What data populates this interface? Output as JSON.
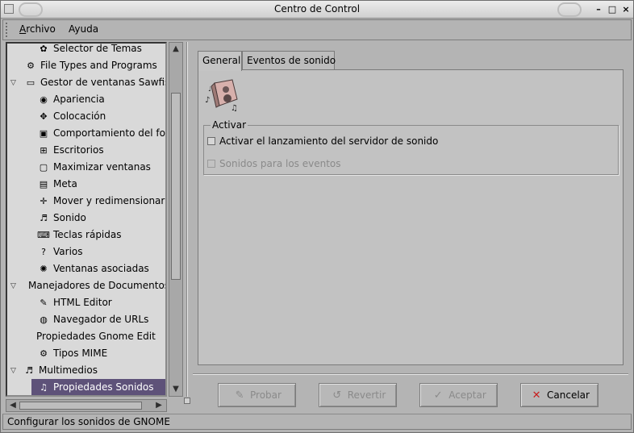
{
  "window": {
    "title": "Centro de Control",
    "minimize_glyph": "–",
    "maximize_glyph": "□",
    "close_glyph": "×"
  },
  "menu": [
    {
      "accel": "A",
      "rest": "rchivo"
    },
    {
      "accel": "A",
      "rest": "yuda"
    }
  ],
  "tree": [
    {
      "label": "Selector de Temas",
      "icon": "theme-icon",
      "level": 2
    },
    {
      "label": "File Types and Programs",
      "icon": "file-types-icon",
      "level": 1
    },
    {
      "label": "Gestor de ventanas Sawfish",
      "icon": "window-manager-icon",
      "level": 1,
      "expanded": true
    },
    {
      "label": "Apariencia",
      "icon": "eye-icon",
      "level": 2
    },
    {
      "label": "Colocación",
      "icon": "placement-icon",
      "level": 2
    },
    {
      "label": "Comportamiento del foco",
      "icon": "focus-icon",
      "level": 2
    },
    {
      "label": "Escritorios",
      "icon": "desktops-icon",
      "level": 2
    },
    {
      "label": "Maximizar ventanas",
      "icon": "maximize-icon",
      "level": 2
    },
    {
      "label": "Meta",
      "icon": "meta-icon",
      "level": 2
    },
    {
      "label": "Mover y redimensionar",
      "icon": "move-resize-icon",
      "level": 2
    },
    {
      "label": "Sonido",
      "icon": "drum-icon",
      "level": 2
    },
    {
      "label": "Teclas rápidas",
      "icon": "keys-icon",
      "level": 2
    },
    {
      "label": "Varios",
      "icon": "misc-icon",
      "level": 2
    },
    {
      "label": "Ventanas asociadas",
      "icon": "linked-windows-icon",
      "level": 2
    },
    {
      "label": "Manejadores de Documentos",
      "icon": "",
      "level": 0,
      "expanded": true
    },
    {
      "label": "HTML Editor",
      "icon": "pen-icon",
      "level": 2
    },
    {
      "label": "Navegador de URLs",
      "icon": "globe-icon",
      "level": 2
    },
    {
      "label": "Propiedades Gnome Edit",
      "icon": "",
      "level": 2
    },
    {
      "label": "Tipos MIME",
      "icon": "mime-icon",
      "level": 2
    },
    {
      "label": "Multimedios",
      "icon": "drum-icon",
      "level": 0,
      "expanded": true
    },
    {
      "label": "Propiedades Sonidos",
      "icon": "sound-props-icon",
      "level": 2,
      "selected": true
    }
  ],
  "tabs": [
    {
      "label": "General",
      "active": true
    },
    {
      "label": "Eventos de sonido",
      "active": false
    }
  ],
  "frame": {
    "label": "Activar"
  },
  "checks": [
    {
      "label": "Activar el lanzamiento del servidor de sonido",
      "checked": false,
      "enabled": true
    },
    {
      "label": "Sonidos para los eventos",
      "checked": false,
      "enabled": false
    }
  ],
  "buttons": [
    {
      "label": "Probar",
      "icon": "test-icon",
      "enabled": false
    },
    {
      "label": "Revertir",
      "icon": "revert-icon",
      "enabled": false
    },
    {
      "label": "Aceptar",
      "icon": "accept-icon",
      "enabled": false
    },
    {
      "label": "Cancelar",
      "icon": "cancel-icon",
      "enabled": true
    }
  ],
  "status": "Configurar los sonidos de GNOME",
  "colors": {
    "selection": "#5e5279",
    "background": "#b4b4b4",
    "cancel_red": "#c81e1e"
  }
}
